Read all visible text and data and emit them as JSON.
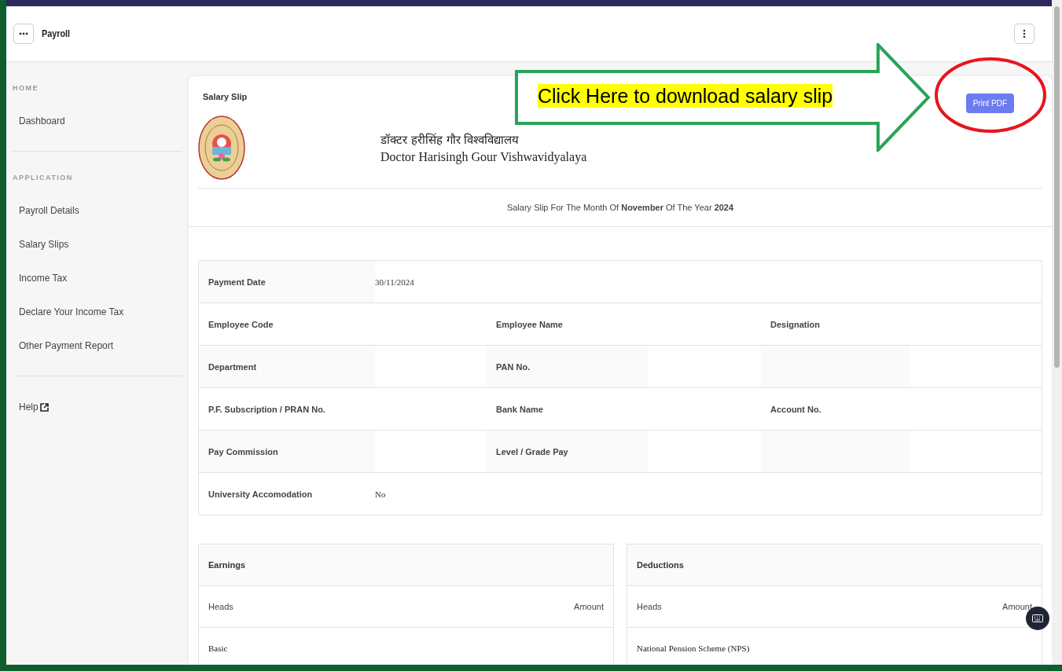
{
  "header": {
    "title": "Payroll"
  },
  "sidebar": {
    "sections": [
      {
        "heading": "HOME",
        "items": [
          {
            "label": "Dashboard",
            "external": false
          }
        ]
      },
      {
        "heading": "APPLICATION",
        "items": [
          {
            "label": "Payroll Details",
            "external": false
          },
          {
            "label": "Salary Slips",
            "external": false
          },
          {
            "label": "Income Tax",
            "external": false
          },
          {
            "label": "Declare Your Income Tax",
            "external": false
          },
          {
            "label": "Other Payment Report",
            "external": false
          }
        ]
      },
      {
        "items": [
          {
            "label": "Help",
            "external": true
          }
        ]
      }
    ]
  },
  "slip": {
    "title": "Salary Slip",
    "print_button": "Print PDF",
    "university_hindi": "डॉक्टर हरीसिंह गौर विश्वविद्यालय",
    "university_english": "Doctor Harisingh Gour Vishwavidyalaya",
    "period": "Salary Slip For The Month Of **November** Of The Year **2024**",
    "details": [
      [
        {
          "label": "Payment Date",
          "value": "30/11/2024"
        }
      ],
      [
        {
          "label": "Employee Code"
        },
        {
          "label": "Employee Name"
        },
        {
          "label": "Designation"
        }
      ],
      [
        {
          "label": "Department"
        },
        {
          "label": "PAN No."
        }
      ],
      [
        {
          "label": "P.F. Subscription / PRAN No."
        },
        {
          "label": "Bank Name"
        },
        {
          "label": "Account No."
        }
      ],
      [
        {
          "label": "Pay Commission"
        },
        {
          "label": "Level / Grade Pay"
        }
      ],
      [
        {
          "label": "University Accomodation",
          "value": "No"
        }
      ]
    ],
    "tables": [
      {
        "title": "Earnings",
        "columns": [
          "Heads",
          "Amount"
        ],
        "rows": [
          [
            "Basic"
          ]
        ]
      },
      {
        "title": "Deductions",
        "columns": [
          "Heads",
          "Amount"
        ],
        "rows": [
          [
            "National Pension Scheme (NPS)"
          ]
        ]
      }
    ]
  },
  "annotation": {
    "text": "Click Here to download salary slip"
  }
}
